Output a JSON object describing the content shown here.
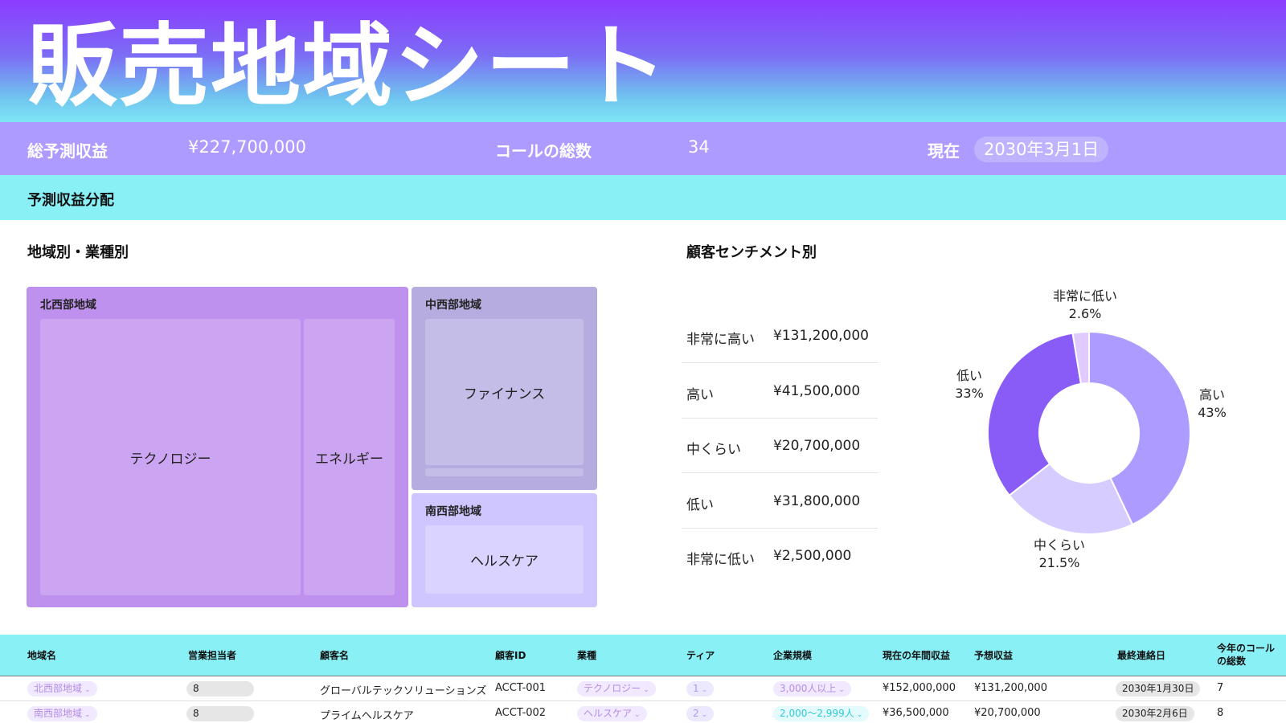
{
  "header": {
    "title": "販売地域シート"
  },
  "kpis": {
    "revenue_label": "総予測収益",
    "revenue_value": "¥227,700,000",
    "calls_label": "コールの総数",
    "calls_value": "34",
    "date_label": "現在",
    "date_value": "2030年3月1日"
  },
  "section": {
    "title": "予測収益分配"
  },
  "treemap": {
    "title": "地域別・業種別",
    "regions": [
      {
        "name": "北西部地域",
        "industries": [
          "テクノロジー",
          "エネルギー"
        ]
      },
      {
        "name": "中西部地域",
        "industries": [
          "ファイナンス"
        ]
      },
      {
        "name": "南西部地域",
        "industries": [
          "ヘルスケア"
        ]
      }
    ]
  },
  "sentiment": {
    "title": "顧客センチメント別",
    "rows": [
      {
        "label": "非常に高い",
        "value": "¥131,200,000"
      },
      {
        "label": "高い",
        "value": "¥41,500,000"
      },
      {
        "label": "中くらい",
        "value": "¥20,700,000"
      },
      {
        "label": "低い",
        "value": "¥31,800,000"
      },
      {
        "label": "非常に低い",
        "value": "¥2,500,000"
      }
    ]
  },
  "chart_data": {
    "type": "pie",
    "donut": true,
    "slices": [
      {
        "label": "高い",
        "percent_label": "43%",
        "value": 43,
        "color": "#ad9bff"
      },
      {
        "label": "中くらい",
        "percent_label": "21.5%",
        "value": 21.5,
        "color": "#d6ccff"
      },
      {
        "label": "低い",
        "percent_label": "33%",
        "value": 33,
        "color": "#8a5cf7"
      },
      {
        "label": "非常に低い",
        "percent_label": "2.6%",
        "value": 2.6,
        "color": "#e1caff"
      }
    ]
  },
  "table": {
    "columns": [
      "地域名",
      "営業担当者",
      "顧客名",
      "顧客ID",
      "業種",
      "ティア",
      "企業規模",
      "現在の年間収益",
      "予想収益",
      "最終連絡日",
      "今年のコール",
      "の総数"
    ],
    "rows": [
      {
        "region": "北西部地域",
        "rep": "8",
        "customer": "グローバルテックソリューションズ",
        "id": "ACCT-001",
        "industry": "テクノロジー",
        "tier": "1",
        "size": "3,000人以上",
        "current": "¥152,000,000",
        "forecast": "¥131,200,000",
        "last_contact": "2030年1月30日",
        "calls": "7"
      },
      {
        "region": "南西部地域",
        "rep": "8",
        "customer": "プライムヘルスケア",
        "id": "ACCT-002",
        "industry": "ヘルスケア",
        "tier": "2",
        "size": "2,000〜2,999人",
        "current": "¥36,500,000",
        "forecast": "¥20,700,000",
        "last_contact": "2030年2月6日",
        "calls": "8"
      }
    ]
  },
  "colors": {
    "kpi_bar": "#ad9bff",
    "section_bar": "#89f0f6",
    "northwest": "#bf91ee",
    "midwest": "#b6acdf",
    "southwest": "#cfc5ff"
  }
}
